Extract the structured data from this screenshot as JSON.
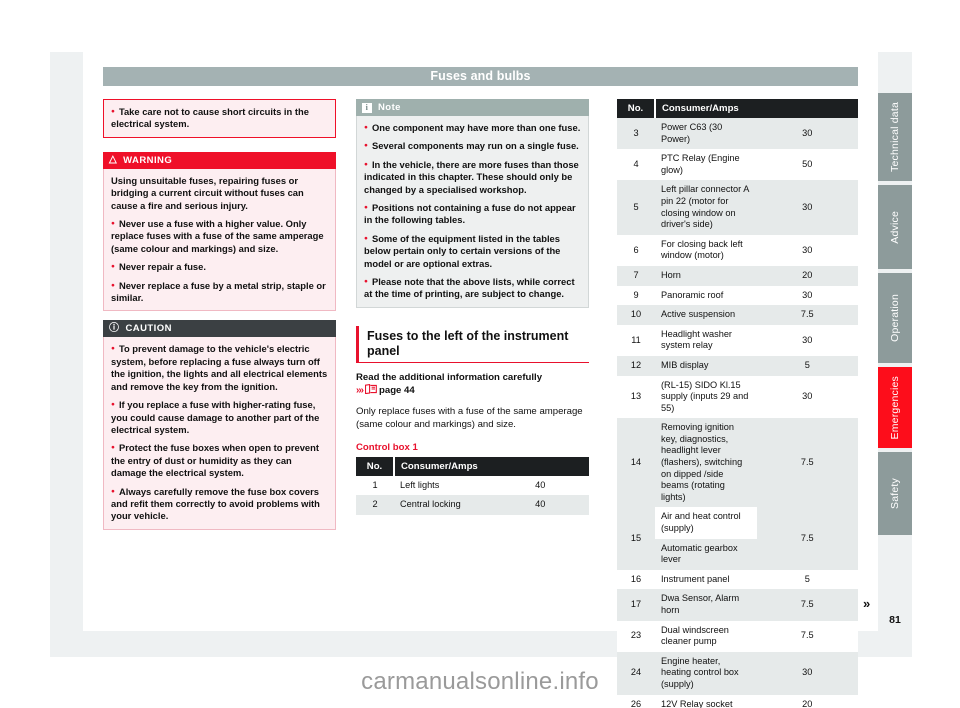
{
  "header": {
    "chapter_title": "Fuses and bulbs"
  },
  "left_column": {
    "intro_note": {
      "bullets": [
        "Take care not to cause short circuits in the electrical system."
      ]
    },
    "warning": {
      "icon": "warning-triangle-icon",
      "label": "WARNING",
      "intro": "Using unsuitable fuses, repairing fuses or bridging a current circuit without fuses can cause a fire and serious injury.",
      "bullets": [
        "Never use a fuse with a higher value. Only replace fuses with a fuse of the same amperage (same colour and markings) and size.",
        "Never repair a fuse.",
        "Never replace a fuse by a metal strip, staple or similar."
      ]
    },
    "caution": {
      "icon": "caution-circle-icon",
      "label": "CAUTION",
      "bullets": [
        "To prevent damage to the vehicle's electric system, before replacing a fuse always turn off the ignition, the lights and all electrical elements and remove the key from the ignition.",
        "If you replace a fuse with higher-rating fuse, you could cause damage to another part of the electrical system.",
        "Protect the fuse boxes when open to prevent the entry of dust or humidity as they can damage the electrical system.",
        "Always carefully remove the fuse box covers and refit them correctly to avoid problems with your vehicle."
      ]
    }
  },
  "mid_column": {
    "note": {
      "icon": "info-icon",
      "label": "Note",
      "bullets": [
        "One component may have more than one fuse.",
        "Several components may run on a single fuse.",
        "In the vehicle, there are more fuses than those indicated in this chapter. These should only be changed by a specialised workshop.",
        "Positions not containing a fuse do not appear in the following tables.",
        "Some of the equipment listed in the tables below pertain only to certain versions of the model or are optional extras.",
        "Please note that the above lists, while correct at the time of printing, are subject to change."
      ]
    },
    "section": {
      "heading": "Fuses to the left of the instrument panel",
      "lead_bold": "Read the additional information carefully",
      "xref_arrows": "›››",
      "xref_icon": "page-reference-icon",
      "xref_text": "page 44",
      "body": "Only replace fuses with a fuse of the same amperage (same colour and markings) and size.",
      "table_caption": "Control box 1"
    },
    "table": {
      "columns": [
        "No.",
        "Consumer/Amps"
      ],
      "rows": [
        {
          "no": "1",
          "consumer": "Left lights",
          "amps": "40"
        },
        {
          "no": "2",
          "consumer": "Central locking",
          "amps": "40"
        }
      ]
    }
  },
  "right_column": {
    "table": {
      "columns": [
        "No.",
        "Consumer/Amps"
      ],
      "rows": [
        {
          "no": "3",
          "consumer": "Power C63 (30 Power)",
          "amps": "30"
        },
        {
          "no": "4",
          "consumer": "PTC Relay (Engine glow)",
          "amps": "50"
        },
        {
          "no": "5",
          "consumer": "Left pillar connector A pin 22 (motor for closing window on driver's side)",
          "amps": "30"
        },
        {
          "no": "6",
          "consumer": "For closing back left window (motor)",
          "amps": "30"
        },
        {
          "no": "7",
          "consumer": "Horn",
          "amps": "20"
        },
        {
          "no": "9",
          "consumer": "Panoramic roof",
          "amps": "30"
        },
        {
          "no": "10",
          "consumer": "Active suspension",
          "amps": "7.5"
        },
        {
          "no": "11",
          "consumer": "Headlight washer system relay",
          "amps": "30"
        },
        {
          "no": "12",
          "consumer": "MIB display",
          "amps": "5"
        },
        {
          "no": "13",
          "consumer": "(RL-15) SIDO Kl.15 supply (inputs 29 and 55)",
          "amps": "30"
        },
        {
          "no": "14",
          "consumer": "Removing ignition key, diagnostics, headlight lever (flashers), switching on dipped /side beams (rotating lights)",
          "amps": "7.5"
        },
        {
          "no": "15",
          "consumer_lines": [
            "Air and heat control (supply)",
            "Automatic gearbox lever"
          ],
          "amps": "7.5"
        },
        {
          "no": "16",
          "consumer": "Instrument panel",
          "amps": "5"
        },
        {
          "no": "17",
          "consumer": "Dwa Sensor, Alarm horn",
          "amps": "7.5"
        },
        {
          "no": "23",
          "consumer": "Dual windscreen cleaner pump",
          "amps": "7.5"
        },
        {
          "no": "24",
          "consumer": "Engine heater, heating control box (supply)",
          "amps": "30"
        },
        {
          "no": "26",
          "consumer": "12V Relay socket",
          "amps": "20"
        }
      ]
    }
  },
  "tabs": [
    {
      "label": "Technical data",
      "active": false,
      "height": 88
    },
    {
      "label": "Advice",
      "active": false,
      "height": 84
    },
    {
      "label": "Operation",
      "active": false,
      "height": 90
    },
    {
      "label": "Emergencies",
      "active": true,
      "height": 81
    },
    {
      "label": "Safety",
      "active": false,
      "height": 83
    }
  ],
  "footer": {
    "continuation_marker": "»",
    "page_number": "81",
    "watermark": "carmanualsonline.info"
  },
  "colors": {
    "accent_red": "#e8112d",
    "warning_red": "#ef1029",
    "caution_dark": "#3b4043",
    "note_green": "#9fb0ad",
    "chapter_bar": "#a4b2b3",
    "tab_grey": "#8d9b9b",
    "tab_active": "#fd0d1b",
    "table_header": "#1c1f21",
    "table_alt_row": "#e6eaea"
  }
}
